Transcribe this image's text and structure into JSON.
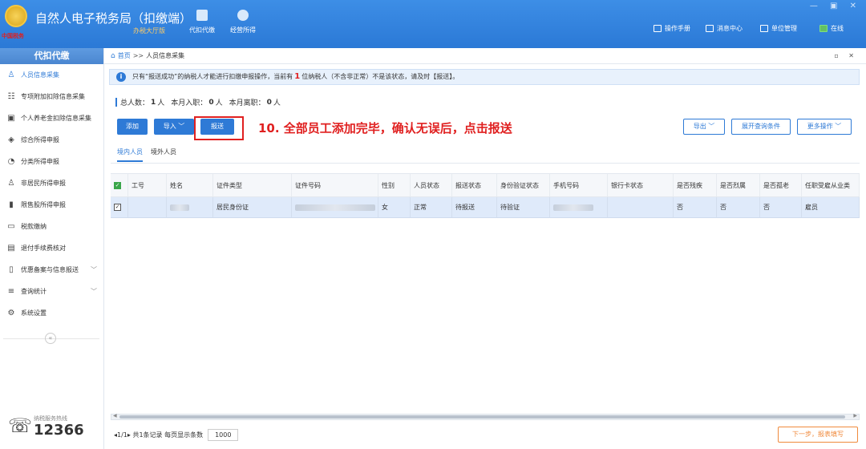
{
  "app": {
    "title": "自然人电子税务局（扣缴端）",
    "subtitle": "办税大厅版",
    "logo_text": "中国税务",
    "nav": [
      {
        "label": "代扣代缴",
        "icon": "wallet-icon"
      },
      {
        "label": "经营所得",
        "icon": "coins-icon"
      }
    ],
    "right_links": [
      {
        "label": "操作手册",
        "icon": "manual-icon"
      },
      {
        "label": "消息中心",
        "icon": "mail-icon"
      },
      {
        "label": "单位管理",
        "icon": "building-icon"
      },
      {
        "label": "在线",
        "icon": "online-icon"
      }
    ],
    "window_controls": "— ▣ ✕"
  },
  "sidebar": {
    "header": "代扣代缴",
    "items": [
      {
        "label": "人员信息采集",
        "icon": "person-icon",
        "glyph": "♙",
        "active": true
      },
      {
        "label": "专项附加扣除信息采集",
        "icon": "list-icon",
        "glyph": "☷"
      },
      {
        "label": "个人养老金扣除信息采集",
        "icon": "pension-icon",
        "glyph": "▣"
      },
      {
        "label": "综合所得申报",
        "icon": "layers-icon",
        "glyph": "◈"
      },
      {
        "label": "分类所得申报",
        "icon": "clock-icon",
        "glyph": "◔"
      },
      {
        "label": "非居民所得申报",
        "icon": "user-icon",
        "glyph": "♙"
      },
      {
        "label": "限售股所得申报",
        "icon": "bar-chart-icon",
        "glyph": "▮"
      },
      {
        "label": "税款缴纳",
        "icon": "card-icon",
        "glyph": "▭"
      },
      {
        "label": "退付手续费核对",
        "icon": "receipt-icon",
        "glyph": "▤"
      },
      {
        "label": "优惠备案与信息报送",
        "icon": "document-icon",
        "glyph": "▯",
        "chevron": "﹀"
      },
      {
        "label": "查询统计",
        "icon": "search-list-icon",
        "glyph": "≡",
        "chevron": "﹀"
      },
      {
        "label": "系统设置",
        "icon": "gear-icon",
        "glyph": "⚙"
      }
    ],
    "collapse": "«",
    "hotline_label": "纳税服务热线",
    "hotline_number": "12366"
  },
  "breadcrumb": {
    "home": "首页",
    "separator": ">>",
    "current": "人员信息采集",
    "controls": "▫ ✕"
  },
  "notice": {
    "part1": "只有“报送成功”的纳税人才能进行扣缴申报操作，当前有",
    "count": "1",
    "part2": "位纳税人（不含非正常）不是该状态，请及时【报送】。"
  },
  "stats": {
    "total_label": "总人数：",
    "total": "1",
    "total_unit": "人",
    "hired_label": "本月入职：",
    "hired": "0",
    "hired_unit": "人",
    "left_label": "本月离职：",
    "left": "0",
    "left_unit": "人"
  },
  "toolbar": {
    "add": "添加",
    "import": "导入 ﹀",
    "submit": "报送",
    "export": "导出 ﹀",
    "expand_query": "展开查询条件",
    "more": "更多操作 ﹀"
  },
  "annotation": "10. 全部员工添加完毕，确认无误后，点击报送",
  "tabs": [
    "境内人员",
    "境外人员"
  ],
  "table": {
    "headers": [
      "工号",
      "姓名",
      "证件类型",
      "证件号码",
      "性别",
      "人员状态",
      "报送状态",
      "身份验证状态",
      "手机号码",
      "银行卡状态",
      "是否残疾",
      "是否烈属",
      "是否孤老",
      "任职受雇从业类"
    ],
    "rows": [
      {
        "id": "",
        "name": "",
        "id_type": "居民身份证",
        "id_number": "",
        "gender": "女",
        "person_status": "正常",
        "submit_status": "待报送",
        "verify_status": "待验证",
        "phone": "",
        "bank_status": "",
        "disabled": "否",
        "martyr": "否",
        "lonely": "否",
        "employment": "雇员"
      }
    ]
  },
  "pager": {
    "text": "◂1/1▸ 共1条记录  每页显示条数",
    "page_size": "1000"
  },
  "next_button": "下一步，报表填写"
}
